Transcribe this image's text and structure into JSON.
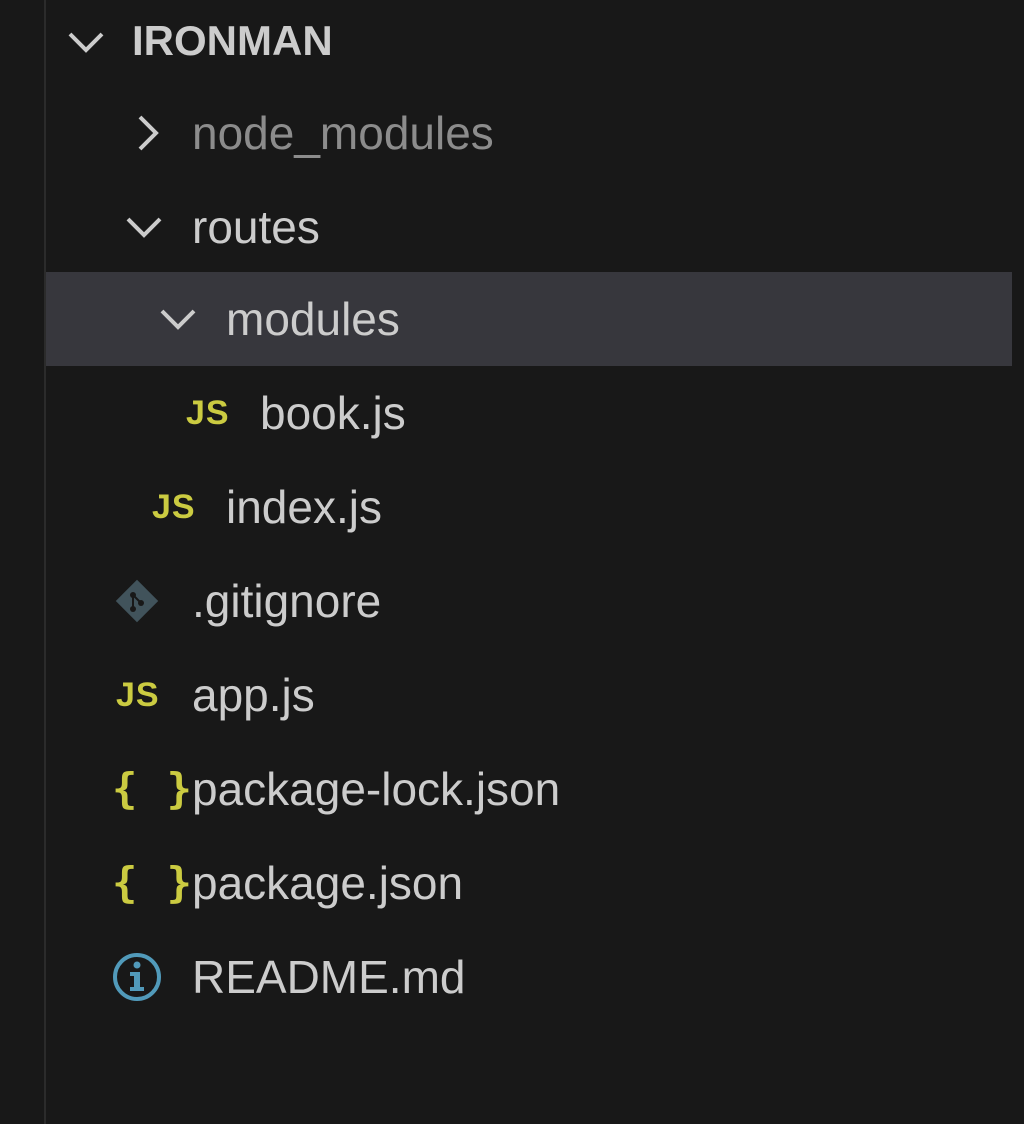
{
  "explorer": {
    "root": {
      "label": "IRONMAN"
    },
    "items": [
      {
        "label": "node_modules",
        "kind": "folder",
        "state": "collapsed"
      },
      {
        "label": "routes",
        "kind": "folder",
        "state": "expanded"
      },
      {
        "label": "modules",
        "kind": "folder",
        "state": "expanded",
        "selected": true
      },
      {
        "label": "book.js",
        "kind": "file",
        "icon": "js-icon",
        "icon_text": "JS"
      },
      {
        "label": "index.js",
        "kind": "file",
        "icon": "js-icon",
        "icon_text": "JS"
      },
      {
        "label": ".gitignore",
        "kind": "file",
        "icon": "git-icon"
      },
      {
        "label": "app.js",
        "kind": "file",
        "icon": "js-icon",
        "icon_text": "JS"
      },
      {
        "label": "package-lock.json",
        "kind": "file",
        "icon": "json-icon",
        "icon_text": "{ }"
      },
      {
        "label": "package.json",
        "kind": "file",
        "icon": "json-icon",
        "icon_text": "{ }"
      },
      {
        "label": "README.md",
        "kind": "file",
        "icon": "info-icon"
      }
    ]
  },
  "colors": {
    "background": "#181818",
    "selection": "#37373d",
    "text": "#cccccc",
    "dim_text": "#8c8c8c",
    "js_yellow": "#cbcb41",
    "info_blue": "#519aba",
    "git_gray": "#41535b"
  }
}
